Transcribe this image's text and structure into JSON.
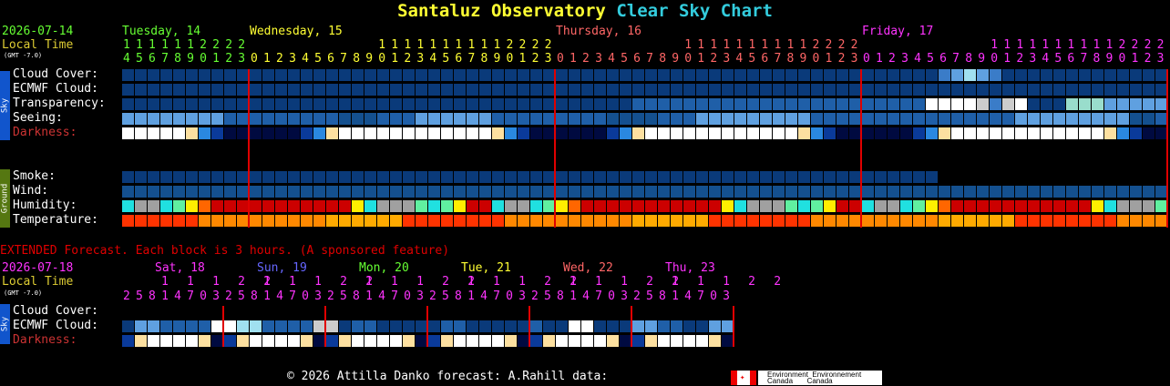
{
  "title": {
    "part1": "Santaluz Observatory",
    "part2": "Clear Sky Chart"
  },
  "colors": {
    "title1": "#ffff33",
    "title2": "#33ccdd",
    "date": "#66ff33",
    "localtime": "#ddcc33",
    "hourline": "#e00000",
    "extended": "#e00000"
  },
  "header": {
    "date": "2026-07-14",
    "local_time": "Local Time",
    "gmt": "(GMT -7.0)"
  },
  "days": [
    {
      "label": "Tuesday, 14",
      "color": "#66ff33",
      "start": 0,
      "hours": 10
    },
    {
      "label": "Wednesday, 15",
      "color": "#ffff33",
      "start": 10,
      "hours": 24
    },
    {
      "label": "Thursday, 16",
      "color": "#ff6666",
      "start": 34,
      "hours": 24
    },
    {
      "label": "Friday, 17",
      "color": "#ff33ff",
      "start": 58,
      "hours": 24
    }
  ],
  "hours_start": 14,
  "tabs": {
    "sky": "Sky",
    "ground": "Ground"
  },
  "rows": {
    "cloud": "Cloud Cover:",
    "ecmwf": "ECMWF Cloud:",
    "transparency": "Transparency:",
    "seeing": "Seeing:",
    "darkness": "Darkness:",
    "smoke": "Smoke:",
    "wind": "Wind:",
    "humidity": "Humidity:",
    "temperature": "Temperature:"
  },
  "extended": {
    "caption": "EXTENDED Forecast. Each block is 3 hours. (A sponsored feature)",
    "date": "2026-07-18",
    "local_time": "Local Time",
    "gmt": "(GMT -7.0)",
    "hours_tens": "1 1 1 2 2",
    "hours_units": "2 5 8 1 4 7 0 3",
    "days": [
      {
        "label": "Sat, 18",
        "color": "#ff33ff"
      },
      {
        "label": "Sun, 19",
        "color": "#6666ff"
      },
      {
        "label": "Mon, 20",
        "color": "#66ff33"
      },
      {
        "label": "Tue, 21",
        "color": "#ffff33"
      },
      {
        "label": "Wed, 22",
        "color": "#ff6666"
      },
      {
        "label": "Thu, 23",
        "color": "#ff33ff"
      }
    ],
    "rows": {
      "cloud": "Cloud Cover:",
      "ecmwf": "ECMWF Cloud:",
      "darkness": "Darkness:"
    }
  },
  "footer": {
    "text": "© 2026 Attilla Danko  forecast: A.Rahill  data:",
    "ec_line1": "Environment  Environnement",
    "ec_line2": "Canada       Canada"
  }
}
